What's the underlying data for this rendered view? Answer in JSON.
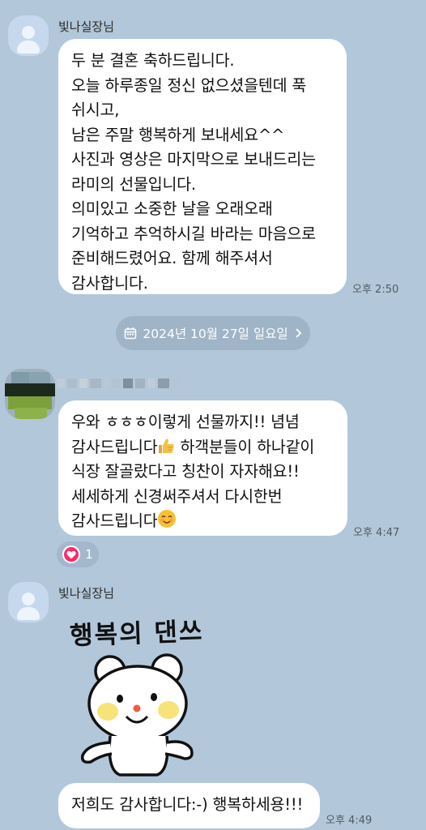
{
  "messages": [
    {
      "sender": "빛나실장님",
      "text": "두 분 결혼 축하드립니다.\n오늘 하루종일 정신 없으셨을텐데 푹\n쉬시고,\n남은 주말 행복하게 보내세요^^\n사진과 영상은 마지막으로 보내드리는\n라미의 선물입니다.\n의미있고 소중한 날을 오래오래\n기억하고 추억하시길 바라는 마음으로\n준비해드렸어요. 함께 해주셔서\n감사합니다.",
      "time": "오후 2:50"
    },
    {
      "line1": "우와 ㅎㅎㅎ이렇게 선물까지!! 념념",
      "line2a": "감사드립니다",
      "line2b": " 하객분들이 하나같이",
      "line3": "식장 잘골랐다고 칭찬이 자자해요!!",
      "line4": "세세하게 신경써주셔서 다시한번",
      "line5": "감사드립니다",
      "time": "오후 4:47",
      "reaction_count": "1"
    },
    {
      "sender": "빛나실장님",
      "sticker_text": "행복의 댄쓰",
      "text": "저희도 감사합니다:-) 행복하세용!!!",
      "time": "오후 4:49"
    }
  ],
  "date_divider": "2024년 10월 27일 일요일",
  "icons": {
    "calendar": "calendar-icon",
    "chevron": "chevron-right-icon",
    "heart": "heart-icon",
    "thumbs_up": "thumbs-up-emoji",
    "smile": "smile-emoji",
    "avatar": "default-avatar-icon",
    "sticker": "bear-sticker"
  },
  "colors": {
    "background": "#b2c7d9",
    "bubble": "#ffffff",
    "reaction_heart": "#ff2a68"
  }
}
